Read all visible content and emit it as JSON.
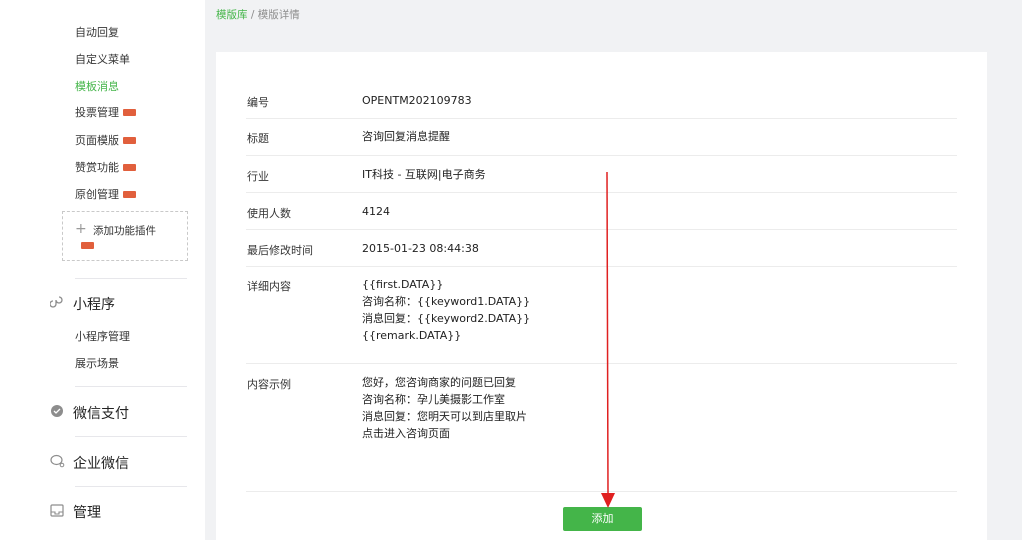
{
  "sidebar": {
    "items": [
      {
        "label": "自动回复",
        "new": false
      },
      {
        "label": "自定义菜单",
        "new": false
      },
      {
        "label": "模板消息",
        "new": false,
        "active": true
      },
      {
        "label": "投票管理",
        "new": true
      },
      {
        "label": "页面模版",
        "new": true
      },
      {
        "label": "赞赏功能",
        "new": true
      },
      {
        "label": "原创管理",
        "new": true
      }
    ],
    "add_plugin": {
      "label": "添加功能插件",
      "new": true,
      "icon": "plus-icon"
    },
    "sections": [
      {
        "title": "小程序",
        "icon": "mini-program-icon",
        "subitems": [
          "小程序管理",
          "展示场景"
        ]
      },
      {
        "title": "微信支付",
        "icon": "wechat-pay-icon"
      },
      {
        "title": "企业微信",
        "icon": "work-wechat-icon"
      },
      {
        "title": "管理",
        "icon": "inbox-icon"
      }
    ]
  },
  "breadcrumb": {
    "root": "模版库",
    "sep": " / ",
    "current": "模版详情"
  },
  "detail": {
    "rows": [
      {
        "key": "编号",
        "value": "OPENTM202109783"
      },
      {
        "key": "标题",
        "value": "咨询回复消息提醒"
      },
      {
        "key": "行业",
        "value": "IT科技 - 互联网|电子商务"
      },
      {
        "key": "使用人数",
        "value": "4124"
      },
      {
        "key": "最后修改时间",
        "value": "2015-01-23 08:44:38"
      },
      {
        "key": "详细内容",
        "lines": [
          "{{first.DATA}}",
          "咨询名称：{{keyword1.DATA}}",
          "消息回复：{{keyword2.DATA}}",
          "{{remark.DATA}}"
        ]
      },
      {
        "key": "内容示例",
        "lines": [
          "您好，您咨询商家的问题已回复",
          "咨询名称：孕儿美摄影工作室",
          "消息回复：您明天可以到店里取片",
          "点击进入咨询页面"
        ]
      }
    ]
  },
  "add_button": {
    "label": "添加"
  },
  "colors": {
    "accent": "#44b549",
    "annotation_arrow": "#e02020",
    "badge": "#e15f3c"
  }
}
